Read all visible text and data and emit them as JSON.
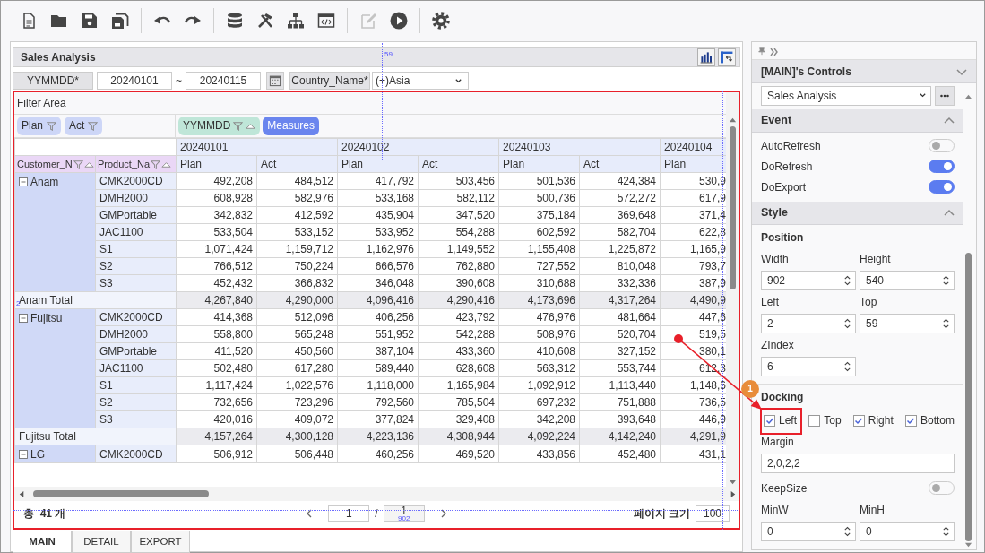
{
  "toolbar": [
    {
      "disabled": false
    },
    {
      "disabled": false
    },
    {
      "disabled": false
    },
    {
      "disabled": false
    },
    {
      "disabled": false
    },
    {
      "disabled": false
    },
    {
      "disabled": false
    },
    {
      "disabled": false
    },
    {
      "disabled": false
    },
    {
      "disabled": false
    },
    {
      "disabled": true
    },
    {
      "disabled": false
    },
    {
      "disabled": false
    }
  ],
  "report": {
    "title": "Sales Analysis",
    "date_filter": {
      "label": "YYMMDD*",
      "from": "20240101",
      "separator": "~",
      "to": "20240115"
    },
    "country_filter": {
      "label": "Country_Name*",
      "value": "(+)Asia"
    },
    "pivot": {
      "filter_area_label": "Filter Area",
      "data_chips": [
        "Plan",
        "Act"
      ],
      "column_chips": [
        {
          "label": "YYMMDD",
          "kind": "field"
        },
        {
          "label": "Measures",
          "kind": "measures"
        }
      ],
      "dates": [
        "20240101",
        "20240102",
        "20240103",
        "20240104"
      ],
      "row_headers": [
        "Customer_N",
        "Product_Na"
      ],
      "measures": [
        "Plan",
        "Act",
        "Plan",
        "Act",
        "Plan",
        "Act",
        "Plan"
      ],
      "groups": [
        {
          "name": "Anam",
          "expanded": true,
          "rows": [
            {
              "product": "CMK2000CD",
              "values": [
                "492,208",
                "484,512",
                "417,792",
                "503,456",
                "501,536",
                "424,384",
                "530,9"
              ]
            },
            {
              "product": "DMH2000",
              "values": [
                "608,928",
                "582,976",
                "533,168",
                "582,112",
                "500,736",
                "572,272",
                "617,9"
              ]
            },
            {
              "product": "GMPortable",
              "values": [
                "342,832",
                "412,592",
                "435,904",
                "347,520",
                "375,184",
                "369,648",
                "371,4"
              ]
            },
            {
              "product": "JAC1100",
              "values": [
                "533,504",
                "533,152",
                "533,952",
                "554,288",
                "602,592",
                "582,704",
                "622,8"
              ]
            },
            {
              "product": "S1",
              "values": [
                "1,071,424",
                "1,159,712",
                "1,162,976",
                "1,149,552",
                "1,155,408",
                "1,225,872",
                "1,165,9"
              ]
            },
            {
              "product": "S2",
              "values": [
                "766,512",
                "750,224",
                "666,576",
                "762,880",
                "727,552",
                "810,048",
                "793,7"
              ]
            },
            {
              "product": "S3",
              "values": [
                "452,432",
                "366,832",
                "346,048",
                "390,608",
                "310,688",
                "332,336",
                "387,9"
              ]
            }
          ],
          "total": {
            "label": "Anam Total",
            "values": [
              "4,267,840",
              "4,290,000",
              "4,096,416",
              "4,290,416",
              "4,173,696",
              "4,317,264",
              "4,490,9"
            ]
          }
        },
        {
          "name": "Fujitsu",
          "expanded": true,
          "rows": [
            {
              "product": "CMK2000CD",
              "values": [
                "414,368",
                "512,096",
                "406,256",
                "423,792",
                "476,976",
                "481,664",
                "447,6"
              ]
            },
            {
              "product": "DMH2000",
              "values": [
                "558,800",
                "565,248",
                "551,952",
                "542,288",
                "508,976",
                "520,704",
                "519,5"
              ]
            },
            {
              "product": "GMPortable",
              "values": [
                "411,520",
                "450,560",
                "387,104",
                "433,360",
                "410,608",
                "327,152",
                "380,1"
              ]
            },
            {
              "product": "JAC1100",
              "values": [
                "502,480",
                "617,280",
                "589,440",
                "628,608",
                "563,312",
                "553,744",
                "612,3"
              ]
            },
            {
              "product": "S1",
              "values": [
                "1,117,424",
                "1,022,576",
                "1,118,000",
                "1,165,984",
                "1,092,912",
                "1,113,440",
                "1,148,6"
              ]
            },
            {
              "product": "S2",
              "values": [
                "732,656",
                "723,296",
                "792,560",
                "785,504",
                "697,232",
                "751,888",
                "736,5"
              ]
            },
            {
              "product": "S3",
              "values": [
                "420,016",
                "409,072",
                "377,824",
                "329,408",
                "342,208",
                "393,648",
                "446,9"
              ]
            }
          ],
          "total": {
            "label": "Fujitsu Total",
            "values": [
              "4,157,264",
              "4,300,128",
              "4,223,136",
              "4,308,944",
              "4,092,224",
              "4,142,240",
              "4,291,9"
            ]
          }
        },
        {
          "name": "LG",
          "expanded": true,
          "rows": [
            {
              "product": "CMK2000CD",
              "values": [
                "506,912",
                "506,448",
                "460,256",
                "469,520",
                "433,856",
                "452,480",
                "431,1"
              ]
            }
          ]
        }
      ]
    },
    "pager": {
      "total": "총  41 개",
      "page": "1",
      "separator": "/",
      "pages": "1",
      "size_label": "페이지 크기",
      "size": "100"
    }
  },
  "tabs": [
    {
      "label": "MAIN",
      "selected": true
    },
    {
      "label": "DETAIL",
      "selected": false
    },
    {
      "label": "EXPORT",
      "selected": false
    }
  ],
  "panel": {
    "title": "[MAIN]'s Controls",
    "control": "Sales Analysis",
    "event": {
      "title": "Event",
      "expanded": true,
      "toggles": [
        {
          "label": "AutoRefresh",
          "on": false
        },
        {
          "label": "DoRefresh",
          "on": true
        },
        {
          "label": "DoExport",
          "on": true
        }
      ]
    },
    "style": {
      "title": "Style",
      "expanded": true,
      "position_label": "Position",
      "position_fields": [
        {
          "label": "Width",
          "value": "902"
        },
        {
          "label": "Height",
          "value": "540"
        },
        {
          "label": "Left",
          "value": "2"
        },
        {
          "label": "Top",
          "value": "59"
        },
        {
          "label": "ZIndex",
          "value": "6"
        }
      ],
      "docking": {
        "label": "Docking",
        "options": [
          {
            "label": "Left",
            "checked": true
          },
          {
            "label": "Top",
            "checked": false
          },
          {
            "label": "Right",
            "checked": true
          },
          {
            "label": "Bottom",
            "checked": true
          }
        ]
      },
      "margin": {
        "label": "Margin",
        "value": "2,0,2,2"
      },
      "keep_size": {
        "label": "KeepSize",
        "on": false
      },
      "min_fields": [
        {
          "label": "MinW",
          "value": "0"
        },
        {
          "label": "MinH",
          "value": "0"
        }
      ]
    }
  },
  "guides": [
    "59",
    "2",
    "902"
  ],
  "annotation": {
    "label": "1"
  }
}
